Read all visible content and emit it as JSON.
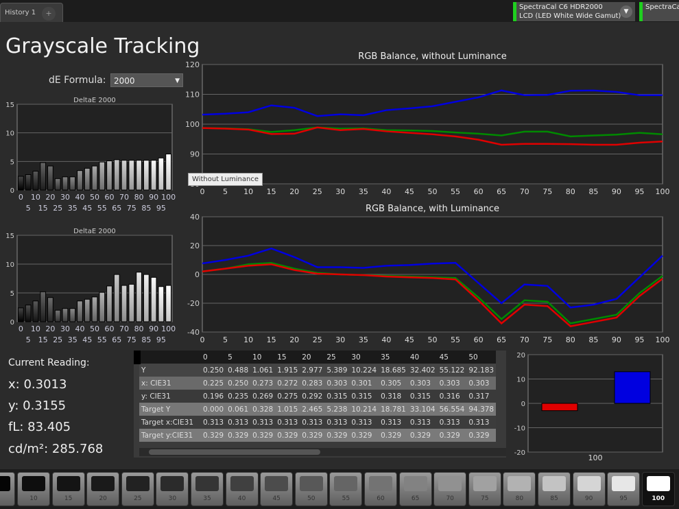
{
  "tabs": {
    "active": "History 1",
    "add": "+"
  },
  "devices": [
    {
      "line1": "SpectraCal C6 HDR2000",
      "line2": "LCD (LED White Wide Gamut)"
    },
    {
      "line1": "SpectraCal"
    }
  ],
  "page_title": "Grayscale Tracking",
  "de_formula": {
    "label": "dE Formula:",
    "value": "2000"
  },
  "tooltip": "Without Luminance",
  "colors": {
    "red": "#e00000",
    "green": "#008a00",
    "blue": "#0000e0",
    "status_green": "#1fcf1f"
  },
  "current_reading": {
    "title": "Current Reading:",
    "x": "x: 0.3013",
    "y": "y: 0.3155",
    "fl": "fL: 83.405",
    "cdm2": "cd/m²: 285.768"
  },
  "table": {
    "columns": [
      "",
      "0",
      "5",
      "10",
      "15",
      "20",
      "25",
      "30",
      "35",
      "40",
      "45",
      "50"
    ],
    "rows": [
      [
        "Y",
        "0.250",
        "0.488",
        "1.061",
        "1.915",
        "2.977",
        "5.389",
        "10.224",
        "18.685",
        "32.402",
        "55.122",
        "92.183"
      ],
      [
        "x: CIE31",
        "0.225",
        "0.250",
        "0.273",
        "0.272",
        "0.283",
        "0.303",
        "0.301",
        "0.305",
        "0.303",
        "0.303",
        "0.303"
      ],
      [
        "y: CIE31",
        "0.196",
        "0.235",
        "0.269",
        "0.275",
        "0.292",
        "0.315",
        "0.315",
        "0.318",
        "0.315",
        "0.316",
        "0.317"
      ],
      [
        "Target Y",
        "0.000",
        "0.061",
        "0.328",
        "1.015",
        "2.465",
        "5.238",
        "10.214",
        "18.781",
        "33.104",
        "56.554",
        "94.378"
      ],
      [
        "Target x:CIE31",
        "0.313",
        "0.313",
        "0.313",
        "0.313",
        "0.313",
        "0.313",
        "0.313",
        "0.313",
        "0.313",
        "0.313",
        "0.313"
      ],
      [
        "Target y:CIE31",
        "0.329",
        "0.329",
        "0.329",
        "0.329",
        "0.329",
        "0.329",
        "0.329",
        "0.329",
        "0.329",
        "0.329",
        "0.329"
      ]
    ]
  },
  "swatches": {
    "labels": [
      "10",
      "15",
      "20",
      "25",
      "30",
      "35",
      "40",
      "45",
      "50",
      "55",
      "60",
      "65",
      "70",
      "75",
      "80",
      "85",
      "90",
      "95",
      "100"
    ],
    "selected": "100"
  },
  "chart_data": [
    {
      "type": "line",
      "title": "RGB Balance, without Luminance",
      "x": [
        0,
        5,
        10,
        15,
        20,
        25,
        30,
        35,
        40,
        45,
        50,
        55,
        60,
        65,
        70,
        75,
        80,
        85,
        90,
        95,
        100
      ],
      "ylim": [
        80,
        120
      ],
      "yticks": [
        80,
        90,
        100,
        110,
        120
      ],
      "grid": true,
      "series": [
        {
          "color": "#0000e0",
          "values": [
            103.2,
            103.5,
            104,
            106.3,
            105.5,
            102.7,
            103.3,
            103,
            104.7,
            105.3,
            106,
            107.5,
            109,
            111.3,
            109.7,
            109.8,
            111.2,
            111.3,
            110.8,
            109.7,
            109.7
          ]
        },
        {
          "color": "#008a00",
          "values": [
            98.7,
            98.6,
            98.3,
            97.4,
            98,
            98.9,
            98.5,
            98.6,
            98,
            97.9,
            97.7,
            97.2,
            96.8,
            96.2,
            97.5,
            97.5,
            95.9,
            96.2,
            96.5,
            97.1,
            96.6
          ]
        },
        {
          "color": "#e00000",
          "values": [
            98.7,
            98.5,
            98.2,
            96.7,
            96.8,
            98.9,
            98,
            98.4,
            97.6,
            97.1,
            96.6,
            95.9,
            94.8,
            93.1,
            93.4,
            93.4,
            93.3,
            93.1,
            93.1,
            93.8,
            94.2
          ]
        }
      ]
    },
    {
      "type": "line",
      "title": "RGB Balance, with Luminance",
      "x": [
        0,
        5,
        10,
        15,
        20,
        25,
        30,
        35,
        40,
        45,
        50,
        55,
        60,
        65,
        70,
        75,
        80,
        85,
        90,
        95,
        100
      ],
      "ylim": [
        -40,
        40
      ],
      "yticks": [
        -40,
        -20,
        0,
        20,
        40
      ],
      "grid": true,
      "series": [
        {
          "color": "#0000e0",
          "values": [
            7.6,
            10,
            13,
            18,
            12,
            5,
            5,
            4.5,
            6,
            6.5,
            7.5,
            8,
            -6,
            -20,
            -7,
            -8,
            -23,
            -21,
            -17,
            -2,
            13
          ]
        },
        {
          "color": "#008a00",
          "values": [
            2,
            4,
            7,
            8,
            4,
            1,
            0,
            -0.5,
            -1,
            -1.5,
            -2,
            -2.5,
            -16,
            -31,
            -18,
            -19,
            -34,
            -31,
            -28,
            -13,
            -1
          ]
        },
        {
          "color": "#e00000",
          "values": [
            2,
            4,
            6,
            7,
            3,
            0.5,
            0,
            -0.5,
            -1.5,
            -2,
            -2.5,
            -3.5,
            -18,
            -34,
            -21,
            -22,
            -36,
            -33,
            -30,
            -15,
            -3
          ]
        }
      ]
    },
    {
      "type": "bar",
      "title": "DeltaE 2000",
      "categories": [
        "0",
        "5",
        "10",
        "15",
        "20",
        "25",
        "30",
        "35",
        "40",
        "45",
        "50",
        "55",
        "60",
        "65",
        "70",
        "75",
        "80",
        "85",
        "90",
        "95",
        "100"
      ],
      "values": [
        2.4,
        2.7,
        3.3,
        4.8,
        4.2,
        2,
        2.3,
        2.3,
        3.4,
        3.8,
        4.2,
        4.9,
        5.1,
        5.3,
        5.2,
        5.2,
        5.2,
        5.2,
        5.2,
        5.6,
        6.3
      ],
      "ylim": [
        0,
        15
      ],
      "yticks": [
        0,
        5,
        10,
        15
      ]
    },
    {
      "type": "bar",
      "title": "DeltaE 2000",
      "categories": [
        "0",
        "5",
        "10",
        "15",
        "20",
        "25",
        "30",
        "35",
        "40",
        "45",
        "50",
        "55",
        "60",
        "65",
        "70",
        "75",
        "80",
        "85",
        "90",
        "95",
        "100"
      ],
      "values": [
        2.4,
        2.9,
        3.6,
        5.2,
        4.2,
        2,
        2.3,
        2.3,
        3.6,
        3.9,
        4.3,
        5.1,
        6.2,
        8.2,
        6.3,
        6.5,
        8.6,
        8.2,
        7.7,
        6.1,
        6.3
      ],
      "ylim": [
        0,
        15
      ],
      "yticks": [
        0,
        5,
        10,
        15
      ]
    },
    {
      "type": "bar",
      "categories": [
        "100"
      ],
      "series": [
        {
          "color": "#e00000",
          "values": [
            -3
          ]
        },
        {
          "color": "#0000e0",
          "values": [
            13
          ]
        }
      ],
      "ylim": [
        -20,
        20
      ],
      "yticks": [
        -20,
        -10,
        0,
        10,
        20
      ]
    }
  ]
}
